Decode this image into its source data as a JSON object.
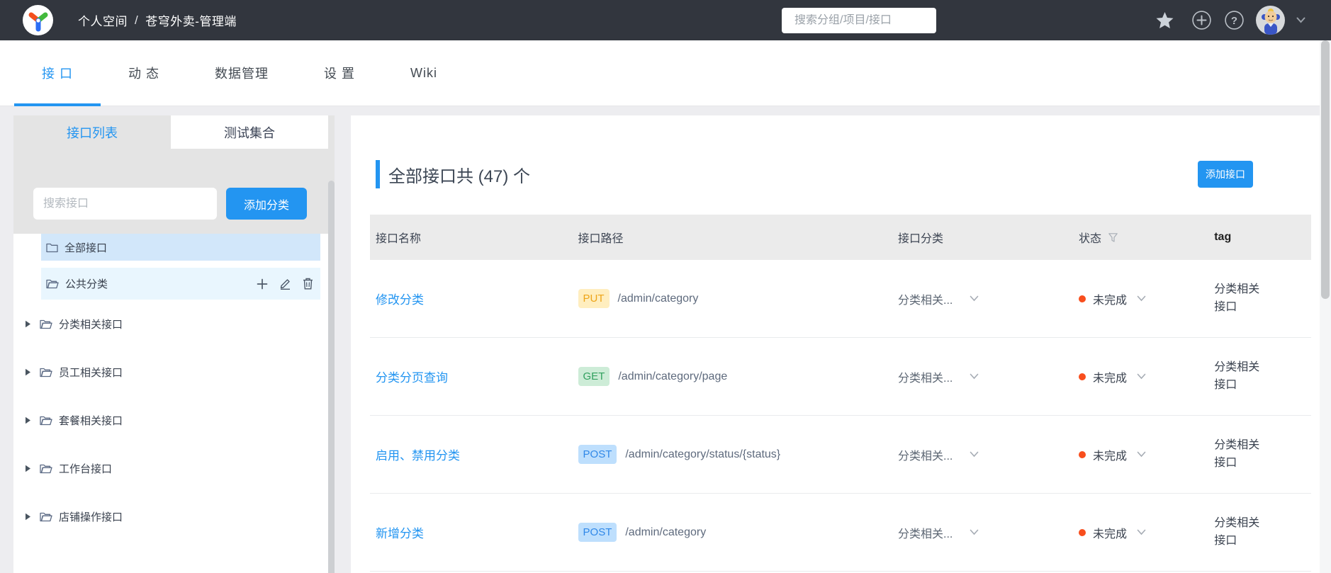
{
  "colors": {
    "primary": "#2395f1",
    "header_bg": "#32363e",
    "page_bg": "#ededf0",
    "sidebar_head_bg": "#e4e4e4",
    "table_head_bg": "#ebebeb",
    "selected_tree_row": "#d2e7fa",
    "hover_tree_row": "#e9f6fe",
    "status_dot": "#f84e1d",
    "method_put": {
      "bg": "#ffeebf",
      "text": "#eda418"
    },
    "method_get": {
      "bg": "#cdecd7",
      "text": "#31a05f"
    },
    "method_post": {
      "bg": "#bedffd",
      "text": "#3088e8"
    }
  },
  "header": {
    "logo_icon": "yapi-logo",
    "breadcrumb": {
      "workspace": "个人空间",
      "separator": "/",
      "project": "苍穹外卖-管理端"
    },
    "search_placeholder": "搜索分组/项目/接口",
    "icons": [
      "search-icon",
      "star-icon",
      "plus-circle-icon",
      "help-circle-icon",
      "avatar",
      "caret-down-icon"
    ]
  },
  "nav_tabs": [
    {
      "label": "接 口",
      "active": true
    },
    {
      "label": "动 态"
    },
    {
      "label": "数据管理"
    },
    {
      "label": "设 置"
    },
    {
      "label": "Wiki"
    }
  ],
  "sidebar": {
    "tabs": [
      {
        "label": "接口列表",
        "active": true
      },
      {
        "label": "测试集合"
      }
    ],
    "search_placeholder": "搜索接口",
    "add_category_button": "添加分类",
    "tree_selected": {
      "label": "全部接口",
      "icon": "folder-icon"
    },
    "tree_active": {
      "label": "公共分类",
      "icon": "folder-open-icon",
      "action_icons": [
        "plus-icon",
        "edit-pencil-icon",
        "trash-icon"
      ]
    },
    "tree_branches": [
      {
        "label": "分类相关接口"
      },
      {
        "label": "员工相关接口"
      },
      {
        "label": "套餐相关接口"
      },
      {
        "label": "工作台接口"
      },
      {
        "label": "店铺操作接口"
      }
    ]
  },
  "main": {
    "title": "全部接口共 (47) 个",
    "add_interface_button": "添加接口",
    "table": {
      "columns": [
        {
          "label": "接口名称"
        },
        {
          "label": "接口路径"
        },
        {
          "label": "接口分类"
        },
        {
          "label": "状态",
          "filter_icon": "funnel-icon"
        },
        {
          "label": "tag"
        }
      ],
      "rows": [
        {
          "name": "修改分类",
          "method": "PUT",
          "path": "/admin/category",
          "category": "分类相关...",
          "status": "未完成",
          "tag": "分类相关接口"
        },
        {
          "name": "分类分页查询",
          "method": "GET",
          "path": "/admin/category/page",
          "category": "分类相关...",
          "status": "未完成",
          "tag": "分类相关接口"
        },
        {
          "name": "启用、禁用分类",
          "method": "POST",
          "path": "/admin/category/status/{status}",
          "category": "分类相关...",
          "status": "未完成",
          "tag": "分类相关接口"
        },
        {
          "name": "新增分类",
          "method": "POST",
          "path": "/admin/category",
          "category": "分类相关...",
          "status": "未完成",
          "tag": "分类相关接口"
        }
      ]
    }
  }
}
